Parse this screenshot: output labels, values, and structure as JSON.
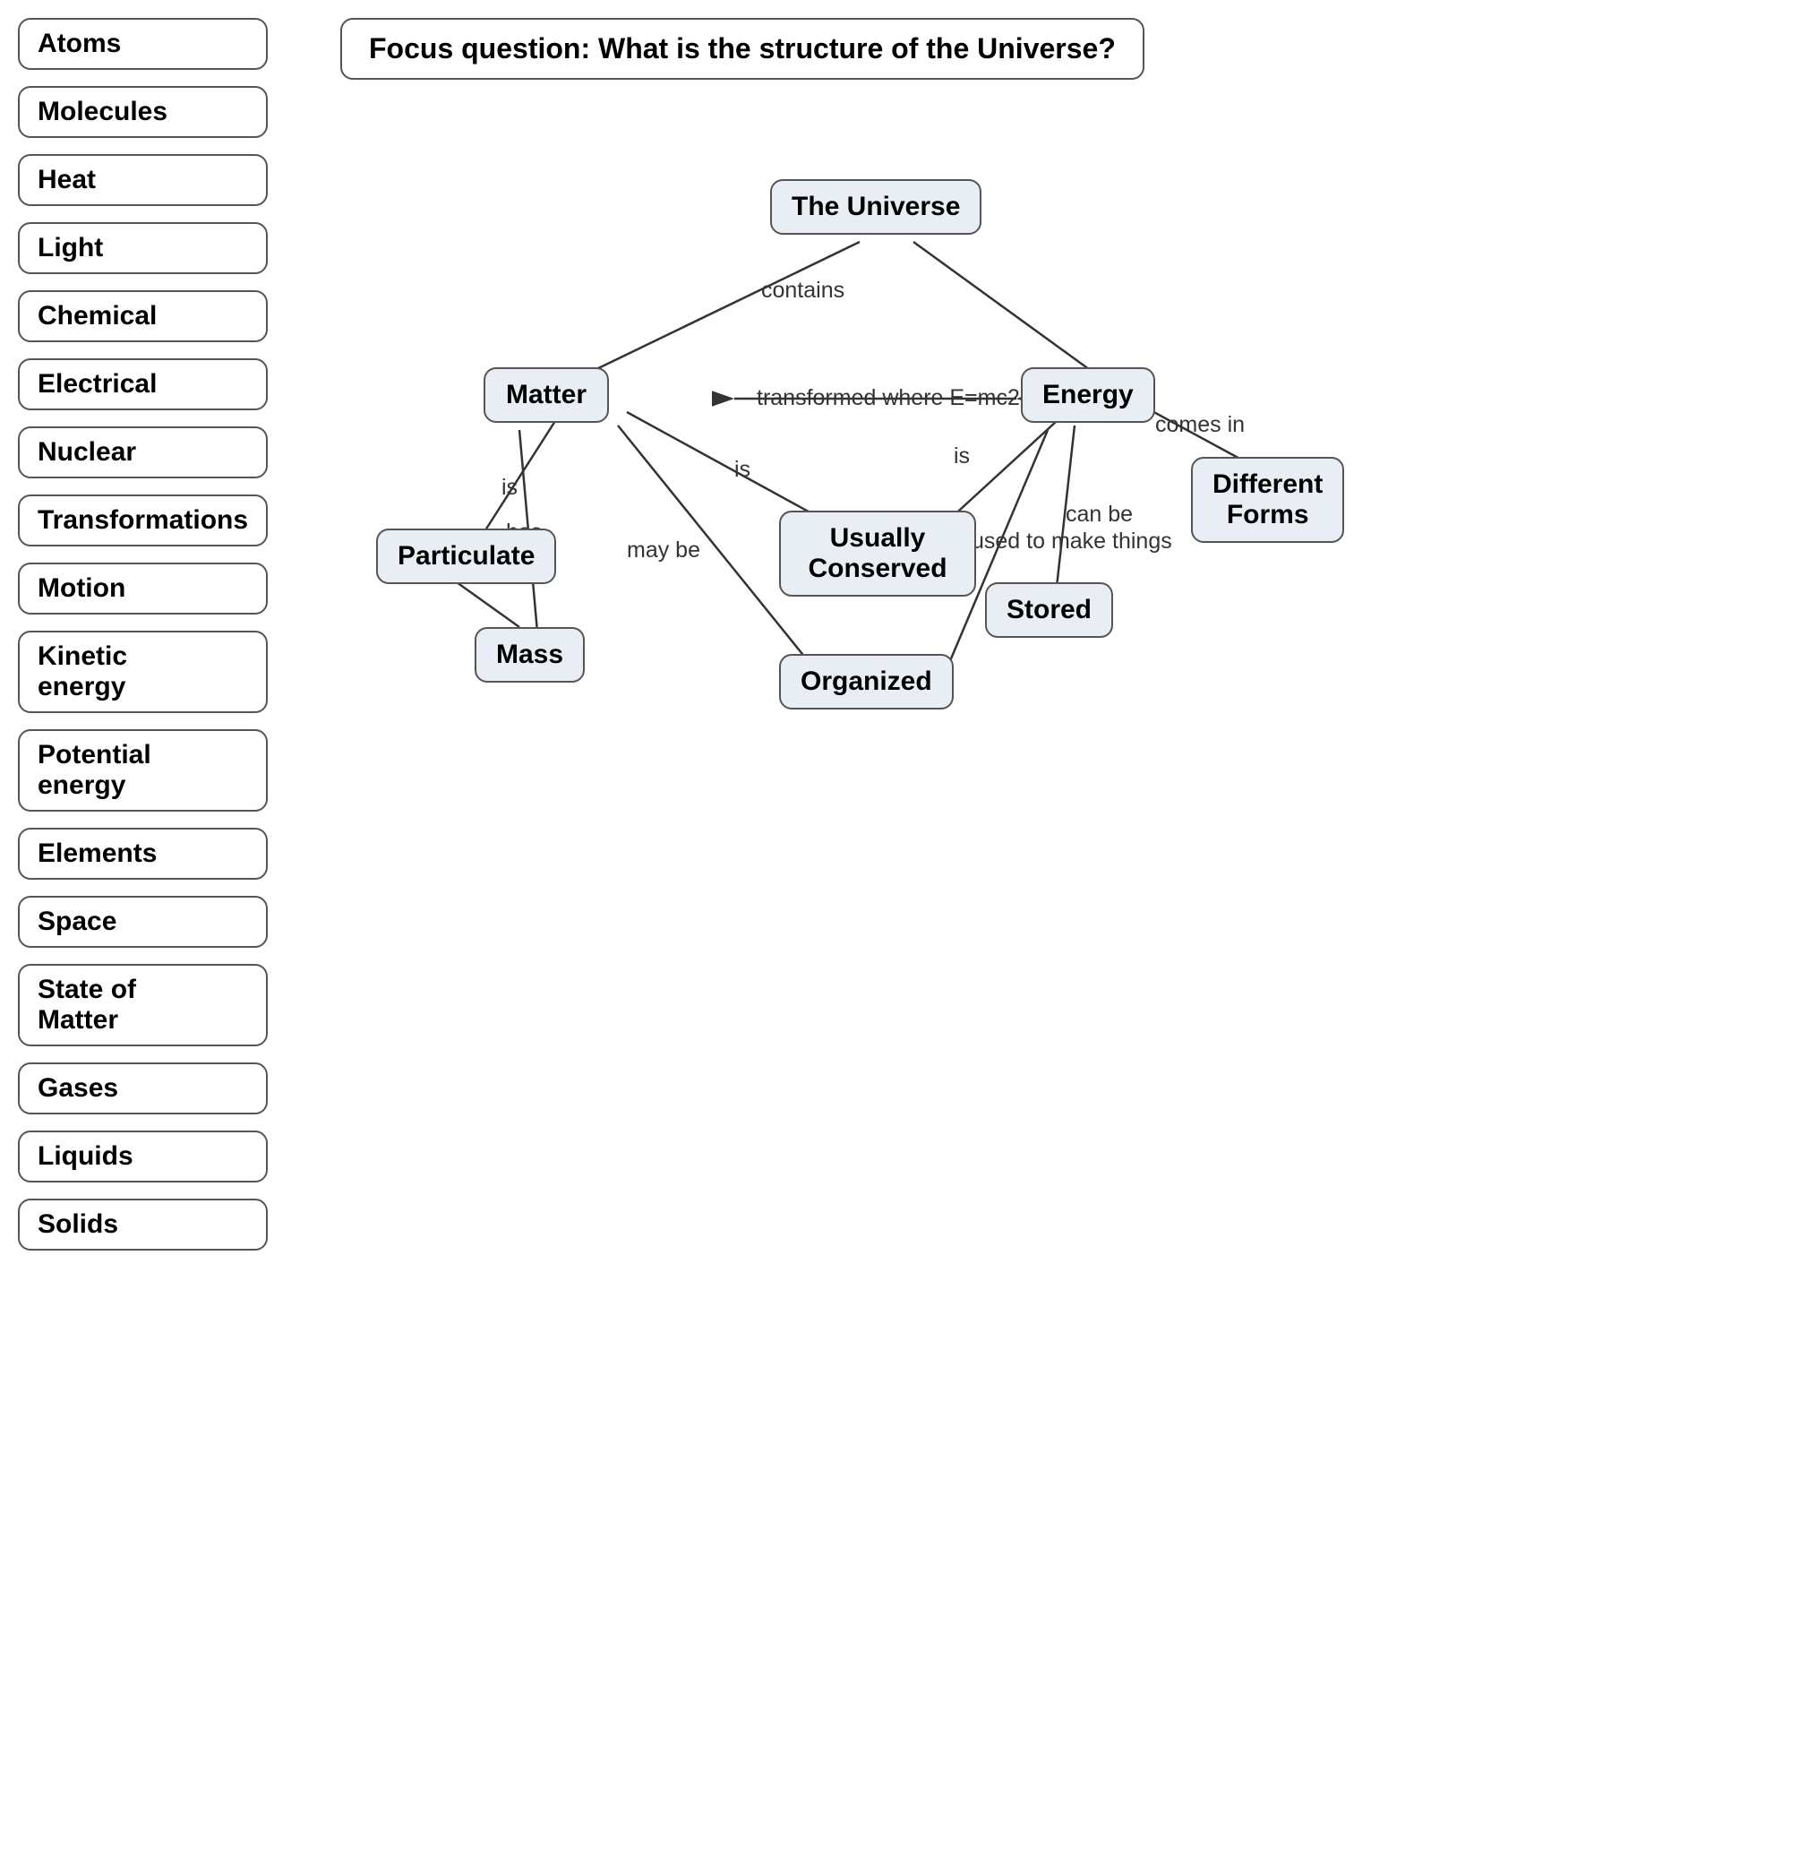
{
  "focus_question": "Focus question: What is the structure of the Universe?",
  "sidebar": {
    "items": [
      {
        "id": "atoms",
        "label": "Atoms"
      },
      {
        "id": "molecules",
        "label": "Molecules"
      },
      {
        "id": "heat",
        "label": "Heat"
      },
      {
        "id": "light",
        "label": "Light"
      },
      {
        "id": "chemical",
        "label": "Chemical"
      },
      {
        "id": "electrical",
        "label": "Electrical"
      },
      {
        "id": "nuclear",
        "label": "Nuclear"
      },
      {
        "id": "transformations",
        "label": "Transformations"
      },
      {
        "id": "motion",
        "label": "Motion"
      },
      {
        "id": "kinetic-energy",
        "label": "Kinetic\nenergy"
      },
      {
        "id": "potential-energy",
        "label": "Potential\nenergy"
      },
      {
        "id": "elements",
        "label": "Elements"
      },
      {
        "id": "space",
        "label": "Space"
      },
      {
        "id": "state-of-matter",
        "label": "State of\nMatter"
      },
      {
        "id": "gases",
        "label": "Gases"
      },
      {
        "id": "liquids",
        "label": "Liquids"
      },
      {
        "id": "solids",
        "label": "Solids"
      }
    ]
  },
  "nodes": {
    "universe": "The Universe",
    "matter": "Matter",
    "energy": "Energy",
    "usually_conserved": "Usually\nConserved",
    "particulate": "Particulate",
    "mass": "Mass",
    "organized": "Organized",
    "stored": "Stored",
    "different_forms": "Different\nForms"
  },
  "link_labels": {
    "contains": "contains",
    "transformed": "transformed\nwhere E=mc2",
    "is_matter": "is",
    "has": "has",
    "may_be": "may\nbe",
    "is_conserved": "is",
    "is_energy": "is",
    "used_to_make": "used to\nmake\nthings",
    "can_be": "can\nbe",
    "comes_in": "comes\nin"
  }
}
